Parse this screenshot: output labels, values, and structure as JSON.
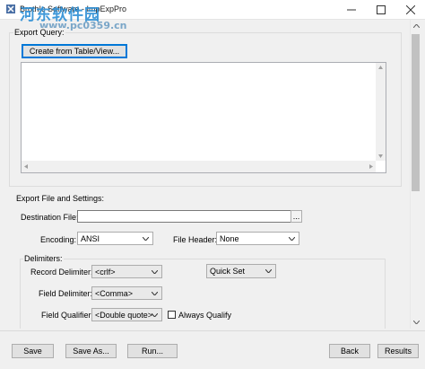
{
  "window": {
    "title": "Broth!c Software - ImpExpPro",
    "watermark": "河东软件园",
    "watermark_url": "www.pc0359.cn"
  },
  "export_query": {
    "legend": "Export Query:",
    "create_button": "Create from Table/View..."
  },
  "export_file": {
    "legend": "Export File and Settings:",
    "destination_label": "Destination File:",
    "destination_value": "",
    "browse_label": "...",
    "encoding_label": "Encoding:",
    "encoding_value": "ANSI",
    "file_header_label": "File Header:",
    "file_header_value": "None"
  },
  "delimiters": {
    "legend": "Delimiters:",
    "record_label": "Record Delimiter:",
    "record_value": "<crlf>",
    "quick_set_value": "Quick Set",
    "field_label": "Field Delimiter:",
    "field_value": "<Comma>",
    "qualifier_label": "Field Qualifier:",
    "qualifier_value": "<Double quote>",
    "always_qualify_label": "Always Qualify"
  },
  "footer": {
    "save": "Save",
    "save_as": "Save As...",
    "run": "Run...",
    "back": "Back",
    "results": "Results"
  }
}
